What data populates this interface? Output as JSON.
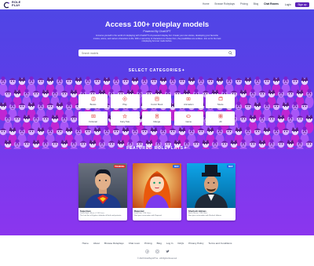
{
  "brand": {
    "line1": "ROLE",
    "line2": "PLAY"
  },
  "nav": {
    "items": [
      "Home",
      "Browse Roleplays",
      "Pricing",
      "Blog"
    ],
    "chat_rooms": "Chat Rooms"
  },
  "auth": {
    "login": "Login",
    "signup": "Sign up"
  },
  "hero": {
    "title": "Access 100+ roleplay models",
    "subtitle": "Powered By ChatGPT",
    "description": "Immerse yourself in the world of roleplaying with ChatGPT's AI-powered roleplay bot. Create your own stories, developing your favourite movies, anime, and cartoon characters to life. With a vast array of characters to choose from, the possibilities are endless. Join us for the best roleplaying bot ever made before.",
    "search_placeholder": "Search models"
  },
  "categories": {
    "title": "SELECT CATEGORIES",
    "items": [
      {
        "label": "Books",
        "icon": "book-icon"
      },
      {
        "label": "Play",
        "icon": "play-icon"
      },
      {
        "label": "Comic Book",
        "icon": "comic-icon"
      },
      {
        "label": "Animation",
        "icon": "animation-icon"
      },
      {
        "label": "Movie",
        "icon": "movie-icon"
      },
      {
        "label": "Fictional",
        "icon": "fictional-icon"
      },
      {
        "label": "Fairy Tale",
        "icon": "fairy-tale-icon"
      },
      {
        "label": "Manga",
        "icon": "manga-icon"
      },
      {
        "label": "Game",
        "icon": "game-icon"
      },
      {
        "label": "All",
        "icon": "all-icon"
      }
    ]
  },
  "featured": {
    "title": "FEATURED ROLEPLAYS",
    "cards": [
      {
        "badge": "TRENDING",
        "badge_color": "#dc2626",
        "name": "Superman",
        "meta": "Comic Book | Movie | 2.1M Users",
        "desc": "The Last Son of Krypton, defender of Earth and protector"
      },
      {
        "badge": "NEW",
        "badge_color": "#2563eb",
        "name": "Rapunzel",
        "meta": "Fairy Tale | 1.5M Users",
        "desc": "Start your conversation with Rapunzel"
      },
      {
        "badge": "NEW",
        "badge_color": "#2563eb",
        "name": "Sherlock Holmes",
        "meta": "Book | Movie | 1.9M Users",
        "desc": "Start your conversation with Sherlock Holmes"
      }
    ]
  },
  "footer": {
    "links": [
      "Home",
      "About",
      "Browse Roleplays",
      "Chat room",
      "Pricing",
      "Blog",
      "Log In",
      "FAQs",
      "Privacy Policy",
      "Terms and Conditions"
    ],
    "copyright": "© 2023 RolePlayGPT.ai - All Rights Reserved"
  },
  "colors": {
    "accent": "#5b21b6",
    "hero_top": "#4f46e5",
    "hero_bottom": "#8b35ee"
  }
}
